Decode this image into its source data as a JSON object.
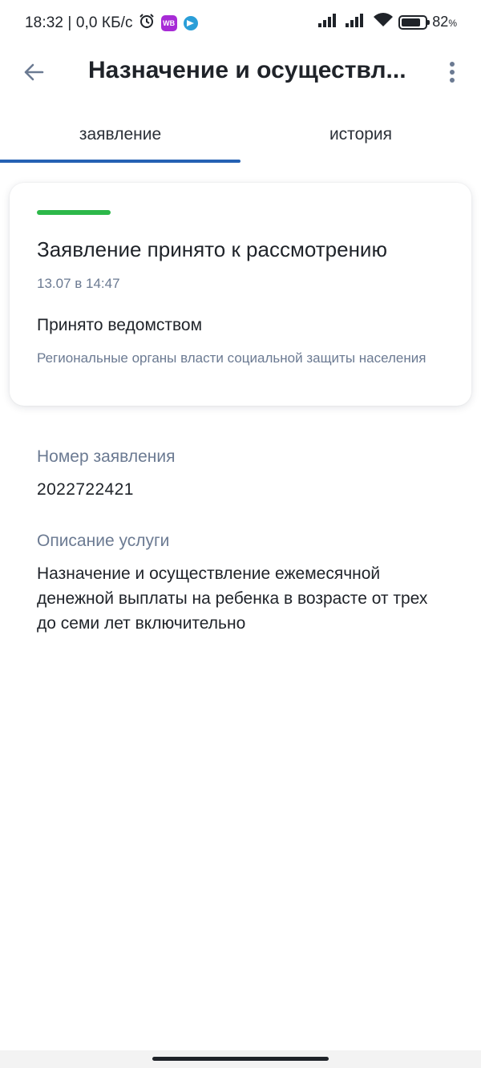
{
  "status_bar": {
    "left_text": "18:32 | 0,0 КБ/с",
    "wb_badge": "WB",
    "battery_percent": "82",
    "battery_level": 0.82,
    "percent_sign": "%"
  },
  "app_bar": {
    "title": "Назначение и осуществл...",
    "back_icon": "arrow-left-icon",
    "more_icon": "more-vertical-icon"
  },
  "tabs": [
    {
      "label": "заявление",
      "active": true
    },
    {
      "label": "история",
      "active": false
    }
  ],
  "status_card": {
    "accent_color": "#2db84a",
    "title": "Заявление принято к рассмотрению",
    "date": "13.07 в 14:47",
    "subtitle": "Принято ведомством",
    "agency": "Региональные органы власти социальной защиты населения"
  },
  "details": {
    "number_label": "Номер заявления",
    "number_value": "2022722421",
    "description_label": "Описание услуги",
    "description_value": "Назначение и осуществление ежемесячной денежной выплаты на ребенка в возрасте от трех до семи лет включительно"
  },
  "colors": {
    "tab_indicator": "#2561b3",
    "secondary_text": "#6b7a92",
    "primary_text": "#1f2329"
  }
}
